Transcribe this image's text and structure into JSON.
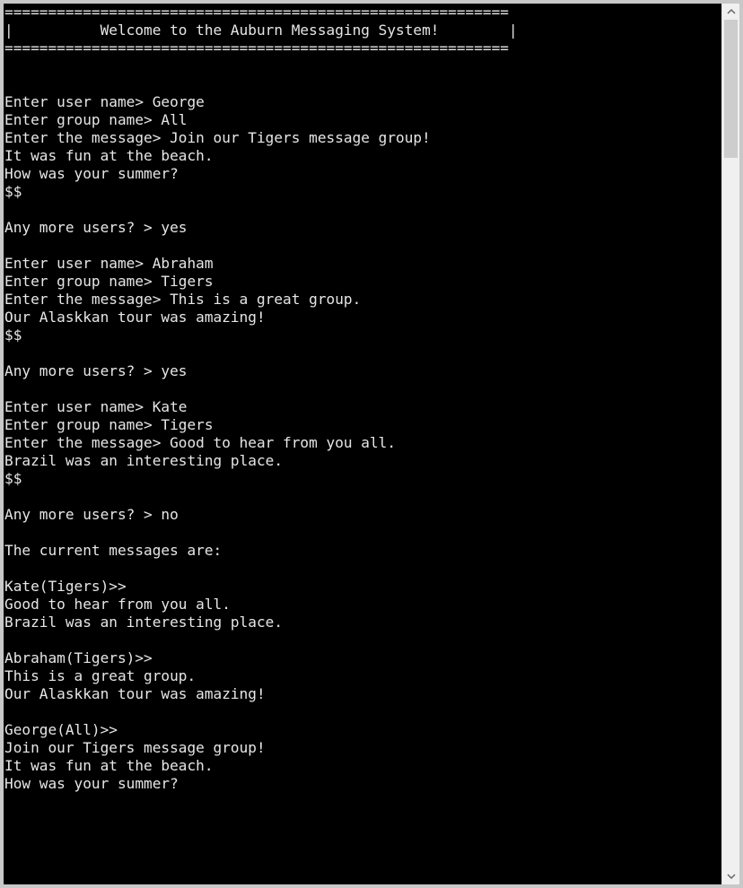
{
  "terminal": {
    "lines": [
      "==========================================================",
      "|          Welcome to the Auburn Messaging System!        |",
      "==========================================================",
      "",
      "",
      "Enter user name> George",
      "Enter group name> All",
      "Enter the message> Join our Tigers message group!",
      "It was fun at the beach.",
      "How was your summer?",
      "$$",
      "",
      "Any more users? > yes",
      "",
      "Enter user name> Abraham",
      "Enter group name> Tigers",
      "Enter the message> This is a great group.",
      "Our Alaskkan tour was amazing!",
      "$$",
      "",
      "Any more users? > yes",
      "",
      "Enter user name> Kate",
      "Enter group name> Tigers",
      "Enter the message> Good to hear from you all.",
      "Brazil was an interesting place.",
      "$$",
      "",
      "Any more users? > no",
      "",
      "The current messages are:",
      "",
      "Kate(Tigers)>>",
      "Good to hear from you all.",
      "Brazil was an interesting place.",
      "",
      "Abraham(Tigers)>>",
      "This is a great group.",
      "Our Alaskkan tour was amazing!",
      "",
      "George(All)>>",
      "Join our Tigers message group!",
      "It was fun at the beach.",
      "How was your summer?"
    ]
  },
  "scrollbar": {
    "up_icon": "chevron-up-icon",
    "down_icon": "chevron-down-icon",
    "scroll_position": 0
  },
  "colors": {
    "background": "#000000",
    "text": "#e6e6e6",
    "frame": "#c8c8c8"
  }
}
